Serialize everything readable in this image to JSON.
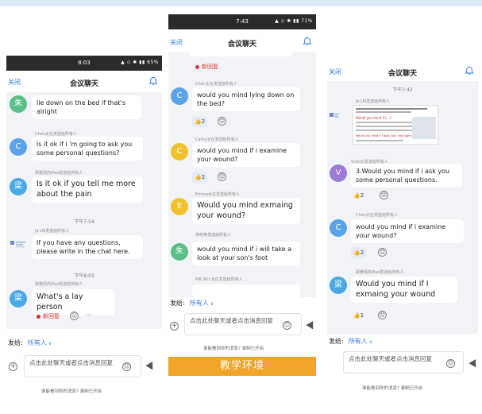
{
  "header": {
    "close": "关闭",
    "title": "会议聊天"
  },
  "phone1": {
    "status_time": "8:03",
    "status_icons": "▲ ◇ ✱ ▮▮ 65%",
    "messages": [
      {
        "avatar": "朱",
        "text": "lie down on the bed if that's alright",
        "color": "#5bbf8a"
      },
      {
        "sender": "Chen太在发送给所有人",
        "avatar": "C",
        "text": "is it ok if i 'm going to ask you some personal questions?",
        "color": "#5aa3e8"
      },
      {
        "sender": "梁雅倩的iPad发送给所有人",
        "avatar": "梁",
        "text": "Is it ok if you tell me more about the pain",
        "color": "#4aa9e4"
      },
      {
        "sender": "Jo LM发送给所有人",
        "text": "If you have any questions, please write in the chat here."
      },
      {
        "sender": "梁雅倩的iPad发送给所有人",
        "avatar": "梁",
        "text": "What's a lay person",
        "color": "#4aa9e4"
      }
    ],
    "time1": "下午7:54",
    "time2": "下午8:03",
    "new_reply": "新回复",
    "more": "···",
    "send_to_label": "发给:",
    "send_to_value": "所有人",
    "input_placeholder": "点击此处聊天或者点击消息回复",
    "hint": "谁能看到你的消息? 录制已开启"
  },
  "phone2": {
    "status_time": "7:43",
    "status_icons": "▲ ◇ ✱ ▮▮ 71%",
    "new_reply": "新回复",
    "messages": [
      {
        "sender": "Chen太在发送给所有人",
        "avatar": "C",
        "text": "would you mind lying down on the bed?",
        "color": "#5aa3e8",
        "react": "👍2"
      },
      {
        "sender": "Cathy太在发送给所有人",
        "avatar": "C",
        "text": "would you mind if i examine your wound?",
        "color": "#f2c12e",
        "react": "👍2"
      },
      {
        "sender": "Emma太在发送给所有人",
        "avatar": "E",
        "text": "Would you mind exmaing your wound?",
        "color": "#f2c12e"
      },
      {
        "sender": "朱晓英发送给所有人",
        "avatar": "朱",
        "text": "would you mind if i will take a look at your son's foot",
        "color": "#5bbf8a"
      },
      {
        "sender": "MR WU 太在发送给所有人"
      }
    ],
    "send_to_label": "发给:",
    "send_to_value": "所有人",
    "input_placeholder": "点击此处聊天或者点击消息回复",
    "hint": "谁能看到你的消息? 录制已开启"
  },
  "phone3": {
    "time": "下午7:42",
    "image_sender": "Jo LM发送给所有人",
    "screenshot_lines": [
      "Would you mind if I...?",
      "Would you mind if I took your vital signs?"
    ],
    "messages": [
      {
        "sender": "Vicki太发送给所有人",
        "avatar": "V",
        "text": "3.Would you mind if i ask you some personal questions.",
        "color": "#9b7ad8",
        "react": "👍2"
      },
      {
        "sender": "Chen太在发送给所有人",
        "avatar": "C",
        "text": "would you mind if i examine your wound?",
        "color": "#5aa3e8",
        "react": "👍2"
      },
      {
        "sender": "梁雅倩的iPad发送给所有人",
        "avatar": "梁",
        "text": "Would you mind if I exmaing your wound",
        "color": "#4aa9e4",
        "react": "👍1"
      }
    ],
    "send_to_label": "发给:",
    "send_to_value": "所有人",
    "input_placeholder": "点击此处聊天或者点击消息回复",
    "hint": "谁能看到你的消息? 录制已开启"
  },
  "banner": "教学环境"
}
